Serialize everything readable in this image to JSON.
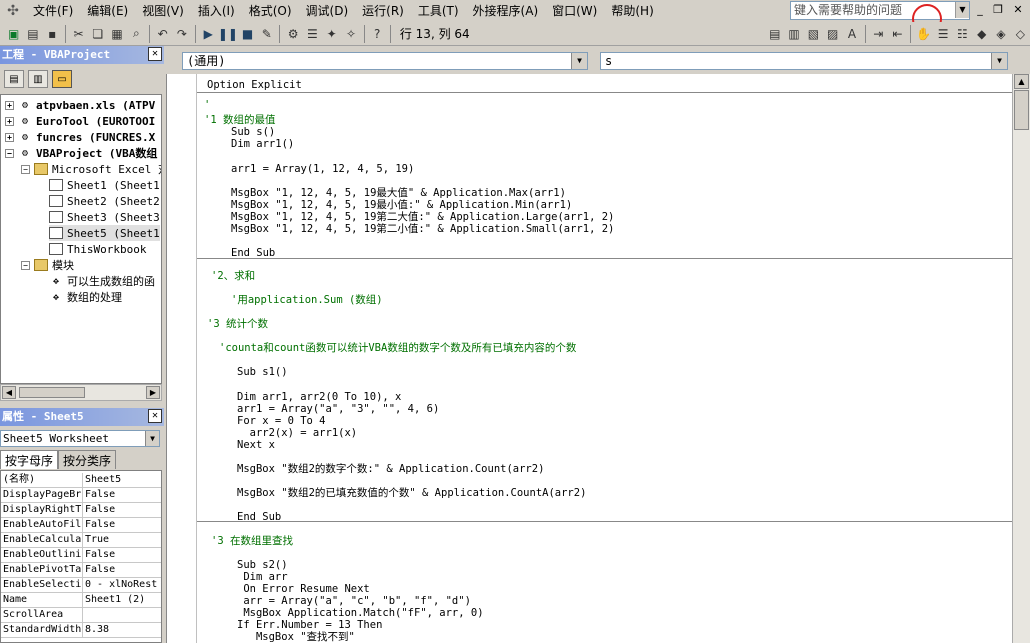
{
  "menu": {
    "items": [
      "文件(F)",
      "编辑(E)",
      "视图(V)",
      "插入(I)",
      "格式(O)",
      "调试(D)",
      "运行(R)",
      "工具(T)",
      "外接程序(A)",
      "窗口(W)",
      "帮助(H)"
    ],
    "help_placeholder": "键入需要帮助的问题"
  },
  "toolbar": {
    "cursor_position": "行 13, 列 64"
  },
  "project_panel": {
    "title": "工程 - VBAProject",
    "tree": [
      {
        "label": "atpvbaen.xls (ATPV",
        "level": 0,
        "expander": "+",
        "icon": "vba-gear-icon",
        "bold": true
      },
      {
        "label": "EuroTool (EUROTOOI",
        "level": 0,
        "expander": "+",
        "icon": "vba-gear-icon",
        "bold": true
      },
      {
        "label": "funcres (FUNCRES.X",
        "level": 0,
        "expander": "+",
        "icon": "vba-gear-icon",
        "bold": true
      },
      {
        "label": "VBAProject (VBA数组",
        "level": 0,
        "expander": "−",
        "icon": "vba-gear-icon",
        "bold": true
      },
      {
        "label": "Microsoft Excel 对",
        "level": 1,
        "expander": "−",
        "icon": "folder-icon",
        "bold": false
      },
      {
        "label": "Sheet1 (Sheet1",
        "level": 2,
        "expander": "",
        "icon": "sheet-icon",
        "bold": false
      },
      {
        "label": "Sheet2 (Sheet2",
        "level": 2,
        "expander": "",
        "icon": "sheet-icon",
        "bold": false
      },
      {
        "label": "Sheet3 (Sheet3",
        "level": 2,
        "expander": "",
        "icon": "sheet-icon",
        "bold": false
      },
      {
        "label": "Sheet5 (Sheet1",
        "level": 2,
        "expander": "",
        "icon": "sheet-icon",
        "bold": false,
        "selected": true
      },
      {
        "label": "ThisWorkbook",
        "level": 2,
        "expander": "",
        "icon": "sheet-icon",
        "bold": false
      },
      {
        "label": "模块",
        "level": 1,
        "expander": "−",
        "icon": "folder-icon",
        "bold": false
      },
      {
        "label": "可以生成数组的函",
        "level": 2,
        "expander": "",
        "icon": "module-icon",
        "bold": false
      },
      {
        "label": "数组的处理",
        "level": 2,
        "expander": "",
        "icon": "module-icon",
        "bold": false
      }
    ]
  },
  "properties_panel": {
    "title": "属性 - Sheet5",
    "object_combo": "Sheet5 Worksheet",
    "tabs": [
      "按字母序",
      "按分类序"
    ],
    "rows": [
      {
        "name": "(名称)",
        "value": "Sheet5"
      },
      {
        "name": "DisplayPageBr",
        "value": "False"
      },
      {
        "name": "DisplayRightT",
        "value": "False"
      },
      {
        "name": "EnableAutoFil",
        "value": "False"
      },
      {
        "name": "EnableCalcula",
        "value": "True"
      },
      {
        "name": "EnableOutlini",
        "value": "False"
      },
      {
        "name": "EnablePivotTa",
        "value": "False"
      },
      {
        "name": "EnableSelecti",
        "value": "0 - xlNoRest"
      },
      {
        "name": "Name",
        "value": "Sheet1 (2)"
      },
      {
        "name": "ScrollArea",
        "value": ""
      },
      {
        "name": "StandardWidth",
        "value": "8.38"
      }
    ]
  },
  "code_window": {
    "object_combo": "(通用)",
    "procedure_combo": "s",
    "lines": [
      {
        "text": "Option Explicit",
        "type": "code",
        "indent": 0
      },
      {
        "text": "'",
        "type": "comment",
        "indent": 0
      },
      {
        "text": "'1 数组的最值",
        "type": "comment",
        "indent": 0
      },
      {
        "text": "Sub s()",
        "type": "code",
        "indent": 1
      },
      {
        "text": "Dim arr1()",
        "type": "code",
        "indent": 1
      },
      {
        "text": "arr1 = Array(1, 12, 4, 5, 19)",
        "type": "code",
        "indent": 1
      },
      {
        "text": "MsgBox \"1, 12, 4, 5, 19最大值\" & Application.Max(arr1)",
        "type": "code",
        "indent": 1
      },
      {
        "text": "MsgBox \"1, 12, 4, 5, 19最小值:\" & Application.Min(arr1)",
        "type": "code",
        "indent": 1
      },
      {
        "text": "MsgBox \"1, 12, 4, 5, 19第二大值:\" & Application.Large(arr1, 2)",
        "type": "code",
        "indent": 1
      },
      {
        "text": "MsgBox \"1, 12, 4, 5, 19第二小值:\" & Application.Small(arr1, 2)",
        "type": "code",
        "indent": 1
      },
      {
        "text": "End Sub",
        "type": "code",
        "indent": 1
      },
      {
        "text": "'2、求和",
        "type": "comment",
        "indent": 0
      },
      {
        "text": "'用application.Sum (数组)",
        "type": "comment",
        "indent": 1
      },
      {
        "text": "'3 统计个数",
        "type": "comment",
        "indent": 0
      },
      {
        "text": "'counta和count函数可以统计VBA数组的数字个数及所有已填充内容的个数",
        "type": "comment",
        "indent": 0
      },
      {
        "text": "Sub s1()",
        "type": "code",
        "indent": 1
      },
      {
        "text": "Dim arr1, arr2(0 To 10), x",
        "type": "code",
        "indent": 1
      },
      {
        "text": "arr1 = Array(\"a\", \"3\", \"\", 4, 6)",
        "type": "code",
        "indent": 1
      },
      {
        "text": "For x = 0 To 4",
        "type": "code",
        "indent": 1
      },
      {
        "text": "  arr2(x) = arr1(x)",
        "type": "code",
        "indent": 1
      },
      {
        "text": "Next x",
        "type": "code",
        "indent": 1
      },
      {
        "text": "MsgBox \"数组2的数字个数:\" & Application.Count(arr2)",
        "type": "code",
        "indent": 1
      },
      {
        "text": "MsgBox \"数组2的已填充数值的个数\" & Application.CountA(arr2)",
        "type": "code",
        "indent": 1
      },
      {
        "text": "End Sub",
        "type": "code",
        "indent": 1
      },
      {
        "text": "'3 在数组里查找",
        "type": "comment",
        "indent": 0
      },
      {
        "text": "Sub s2()",
        "type": "code",
        "indent": 1
      },
      {
        "text": " Dim arr",
        "type": "code",
        "indent": 1
      },
      {
        "text": " On Error Resume Next",
        "type": "code",
        "indent": 1
      },
      {
        "text": " arr = Array(\"a\", \"c\", \"b\", \"f\", \"d\")",
        "type": "code",
        "indent": 1
      },
      {
        "text": " MsgBox Application.Match(\"fF\", arr, 0)",
        "type": "code",
        "indent": 1
      },
      {
        "text": "If Err.Number = 13 Then",
        "type": "code",
        "indent": 1
      },
      {
        "text": "   MsgBox \"查找不到\"",
        "type": "code",
        "indent": 1
      }
    ]
  }
}
